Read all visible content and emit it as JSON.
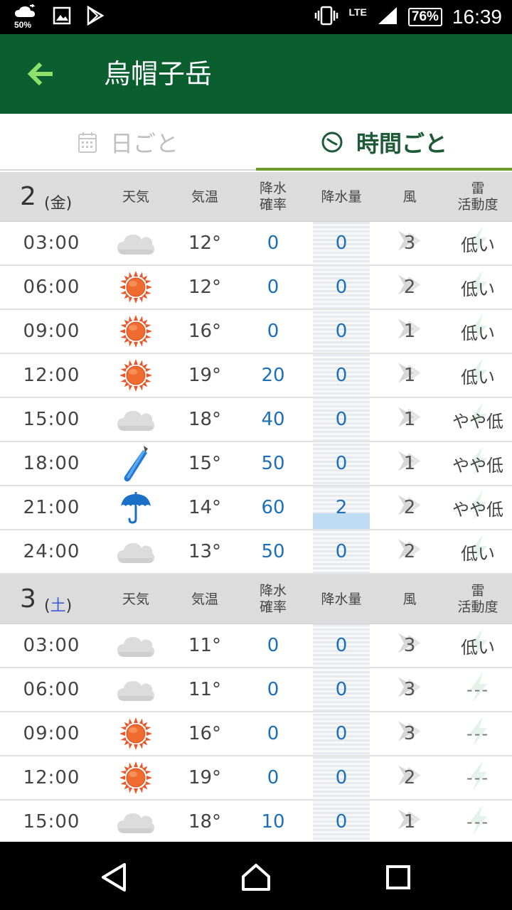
{
  "status_bar": {
    "weather_percent": "50%",
    "network": "LTE",
    "battery": "76%",
    "time": "16:39"
  },
  "app_bar": {
    "title": "烏帽子岳"
  },
  "tabs": [
    {
      "label": "日ごと",
      "selected": false
    },
    {
      "label": "時間ごと",
      "selected": true
    }
  ],
  "column_headers": {
    "weather": "天気",
    "temperature": "気温",
    "precip_prob_line1": "降水",
    "precip_prob_line2": "確率",
    "precip_amount": "降水量",
    "wind": "風",
    "thunder_line1": "雷",
    "thunder_line2": "活動度"
  },
  "colors": {
    "app_bar": "#0b5e2f",
    "back_arrow": "#8ee06a",
    "tab_underline": "#6c9a2a",
    "value_blue": "#1d6fb8",
    "saturday": "#3f5bd6"
  },
  "days": [
    {
      "day": "2",
      "dow_open": "(",
      "dow": "金",
      "dow_close": ")",
      "saturday": false,
      "rows": [
        {
          "time": "03:00",
          "weather_icon": "cloud-icon",
          "temp": "12°",
          "prob": "0",
          "amount": "0",
          "wet": false,
          "wind": "3",
          "thunder": "低い"
        },
        {
          "time": "06:00",
          "weather_icon": "sun-icon",
          "temp": "12°",
          "prob": "0",
          "amount": "0",
          "wet": false,
          "wind": "2",
          "thunder": "低い"
        },
        {
          "time": "09:00",
          "weather_icon": "sun-icon",
          "temp": "16°",
          "prob": "0",
          "amount": "0",
          "wet": false,
          "wind": "1",
          "thunder": "低い"
        },
        {
          "time": "12:00",
          "weather_icon": "sun-icon",
          "temp": "19°",
          "prob": "20",
          "amount": "0",
          "wet": false,
          "wind": "1",
          "thunder": "低い"
        },
        {
          "time": "15:00",
          "weather_icon": "cloud-icon",
          "temp": "18°",
          "prob": "40",
          "amount": "0",
          "wet": false,
          "wind": "1",
          "thunder": "やや低"
        },
        {
          "time": "18:00",
          "weather_icon": "closed-umbrella-icon",
          "temp": "15°",
          "prob": "50",
          "amount": "0",
          "wet": false,
          "wind": "1",
          "thunder": "やや低"
        },
        {
          "time": "21:00",
          "weather_icon": "umbrella-icon",
          "temp": "14°",
          "prob": "60",
          "amount": "2",
          "wet": true,
          "wind": "2",
          "thunder": "やや低"
        },
        {
          "time": "24:00",
          "weather_icon": "cloud-icon",
          "temp": "13°",
          "prob": "50",
          "amount": "0",
          "wet": false,
          "wind": "2",
          "thunder": "低い"
        }
      ]
    },
    {
      "day": "3",
      "dow_open": "(",
      "dow": "土",
      "dow_close": ")",
      "saturday": true,
      "rows": [
        {
          "time": "03:00",
          "weather_icon": "cloud-icon",
          "temp": "11°",
          "prob": "0",
          "amount": "0",
          "wet": false,
          "wind": "3",
          "thunder": "低い"
        },
        {
          "time": "06:00",
          "weather_icon": "cloud-icon",
          "temp": "11°",
          "prob": "0",
          "amount": "0",
          "wet": false,
          "wind": "3",
          "thunder": "---"
        },
        {
          "time": "09:00",
          "weather_icon": "sun-icon",
          "temp": "16°",
          "prob": "0",
          "amount": "0",
          "wet": false,
          "wind": "3",
          "thunder": "---"
        },
        {
          "time": "12:00",
          "weather_icon": "sun-icon",
          "temp": "19°",
          "prob": "0",
          "amount": "0",
          "wet": false,
          "wind": "2",
          "thunder": "---"
        },
        {
          "time": "15:00",
          "weather_icon": "cloud-icon",
          "temp": "18°",
          "prob": "10",
          "amount": "0",
          "wet": false,
          "wind": "1",
          "thunder": "---"
        }
      ]
    }
  ]
}
